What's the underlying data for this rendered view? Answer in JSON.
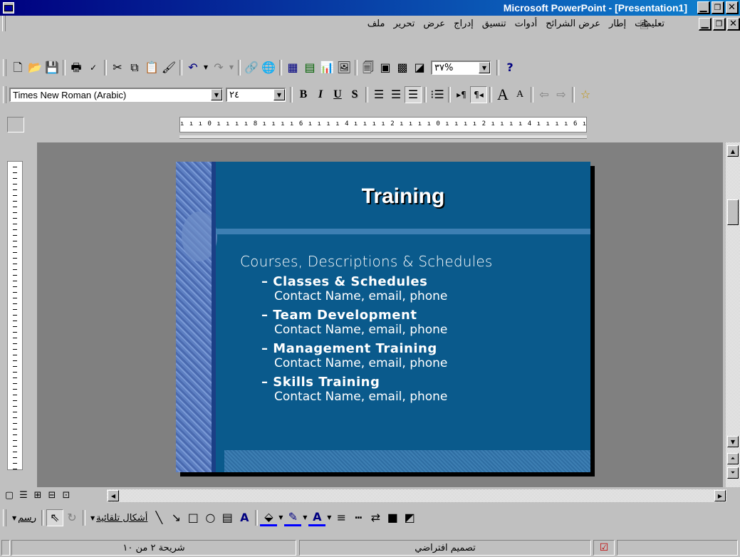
{
  "window": {
    "title": "Microsoft PowerPoint - [Presentation1]",
    "controls": {
      "minimize": "_",
      "restore": "🗗",
      "close": "X"
    }
  },
  "menu": {
    "items": [
      "ملف",
      "تحرير",
      "عرض",
      "إدراج",
      "تنسيق",
      "أدوات",
      "عرض الشرائح",
      "إطار",
      "تعليمات"
    ]
  },
  "standard_toolbar": {
    "zoom": "٣٧%"
  },
  "formatting_toolbar": {
    "font": "Times New Roman (Arabic)",
    "size": "٢٤",
    "bold": "B",
    "italic": "I",
    "underline": "U",
    "shadow": "S"
  },
  "ruler": {
    "horizontal": "ı ı ı 0 ı ı ı ı 8 ı ı ı ı 6 ı ı ı ı 4 ı ı ı ı 2 ı ı ı ı 0 ı ı ı ı 2 ı ı ı ı 4 ı ı ı ı 6 ı ı ı ı 8 ı ı ı ı 0 ı ı ı ı"
  },
  "slide": {
    "title": "Training",
    "body_heading": "Courses, Descriptions & Schedules",
    "bullets": [
      {
        "title": "– Classes & Schedules",
        "sub": "Contact Name, email, phone"
      },
      {
        "title": "– Team Development",
        "sub": "Contact Name, email, phone"
      },
      {
        "title": "– Management Training",
        "sub": "Contact Name, email, phone"
      },
      {
        "title": "– Skills Training",
        "sub": "Contact Name, email, phone"
      }
    ],
    "colors": {
      "background": "#0a5a8c",
      "band": "#3d7fb3",
      "text": "#ffffff"
    }
  },
  "drawing_toolbar": {
    "draw": "رسم",
    "autoshapes": "أشكال تلقائية"
  },
  "status_bar": {
    "slide_of": "شريحة ٢ من ١٠",
    "design": "تصميم افتراضي"
  }
}
